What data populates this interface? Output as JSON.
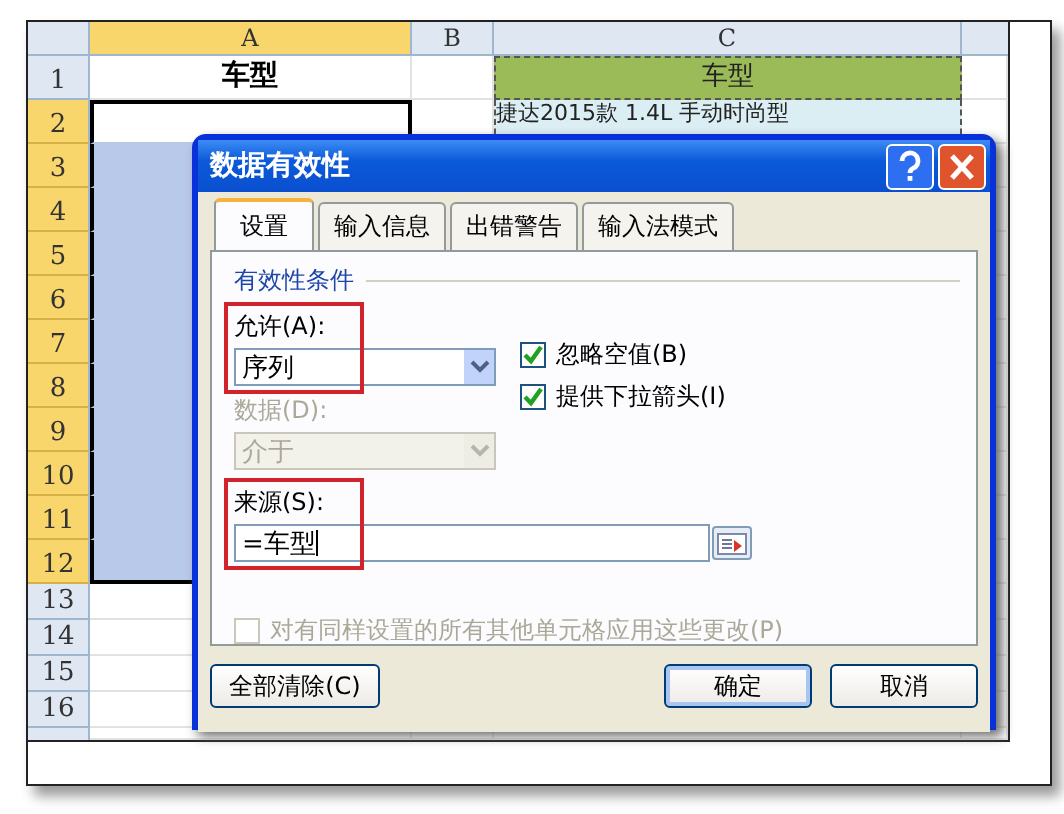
{
  "sheet": {
    "columns": [
      {
        "label": "A",
        "selected": true
      },
      {
        "label": "B",
        "selected": false
      },
      {
        "label": "C",
        "selected": false
      }
    ],
    "rows": [
      {
        "label": "1",
        "selected": false
      },
      {
        "label": "2",
        "selected": true
      },
      {
        "label": "3",
        "selected": true
      },
      {
        "label": "4",
        "selected": true
      },
      {
        "label": "5",
        "selected": true
      },
      {
        "label": "6",
        "selected": true
      },
      {
        "label": "7",
        "selected": true
      },
      {
        "label": "8",
        "selected": true
      },
      {
        "label": "9",
        "selected": true
      },
      {
        "label": "10",
        "selected": true
      },
      {
        "label": "11",
        "selected": true
      },
      {
        "label": "12",
        "selected": true
      },
      {
        "label": "13",
        "selected": false
      },
      {
        "label": "14",
        "selected": false
      },
      {
        "label": "15",
        "selected": false
      },
      {
        "label": "16",
        "selected": false
      }
    ],
    "a1": "车型",
    "c1": "车型",
    "c2": "捷达2015款 1.4L 手动时尚型"
  },
  "dialog": {
    "title": "数据有效性",
    "tabs": [
      {
        "label": "设置",
        "selected": true
      },
      {
        "label": "输入信息",
        "selected": false
      },
      {
        "label": "出错警告",
        "selected": false
      },
      {
        "label": "输入法模式",
        "selected": false
      }
    ],
    "section": "有效性条件",
    "allow": {
      "label": "允许(A):",
      "value": "序列",
      "highlighted": true
    },
    "checks": [
      {
        "label": "忽略空值(B)",
        "checked": true
      },
      {
        "label": "提供下拉箭头(I)",
        "checked": true
      }
    ],
    "data": {
      "label": "数据(D):",
      "value": "介于",
      "disabled": true
    },
    "source": {
      "label": "来源(S):",
      "value": "=车型",
      "highlighted": true
    },
    "apply_all": {
      "label": "对有同样设置的所有其他单元格应用这些更改(P)",
      "checked": false,
      "disabled": true
    },
    "buttons": [
      {
        "label": "全部清除(C)",
        "default": false
      },
      {
        "label": "确定",
        "default": true
      },
      {
        "label": "取消",
        "default": false
      }
    ]
  }
}
